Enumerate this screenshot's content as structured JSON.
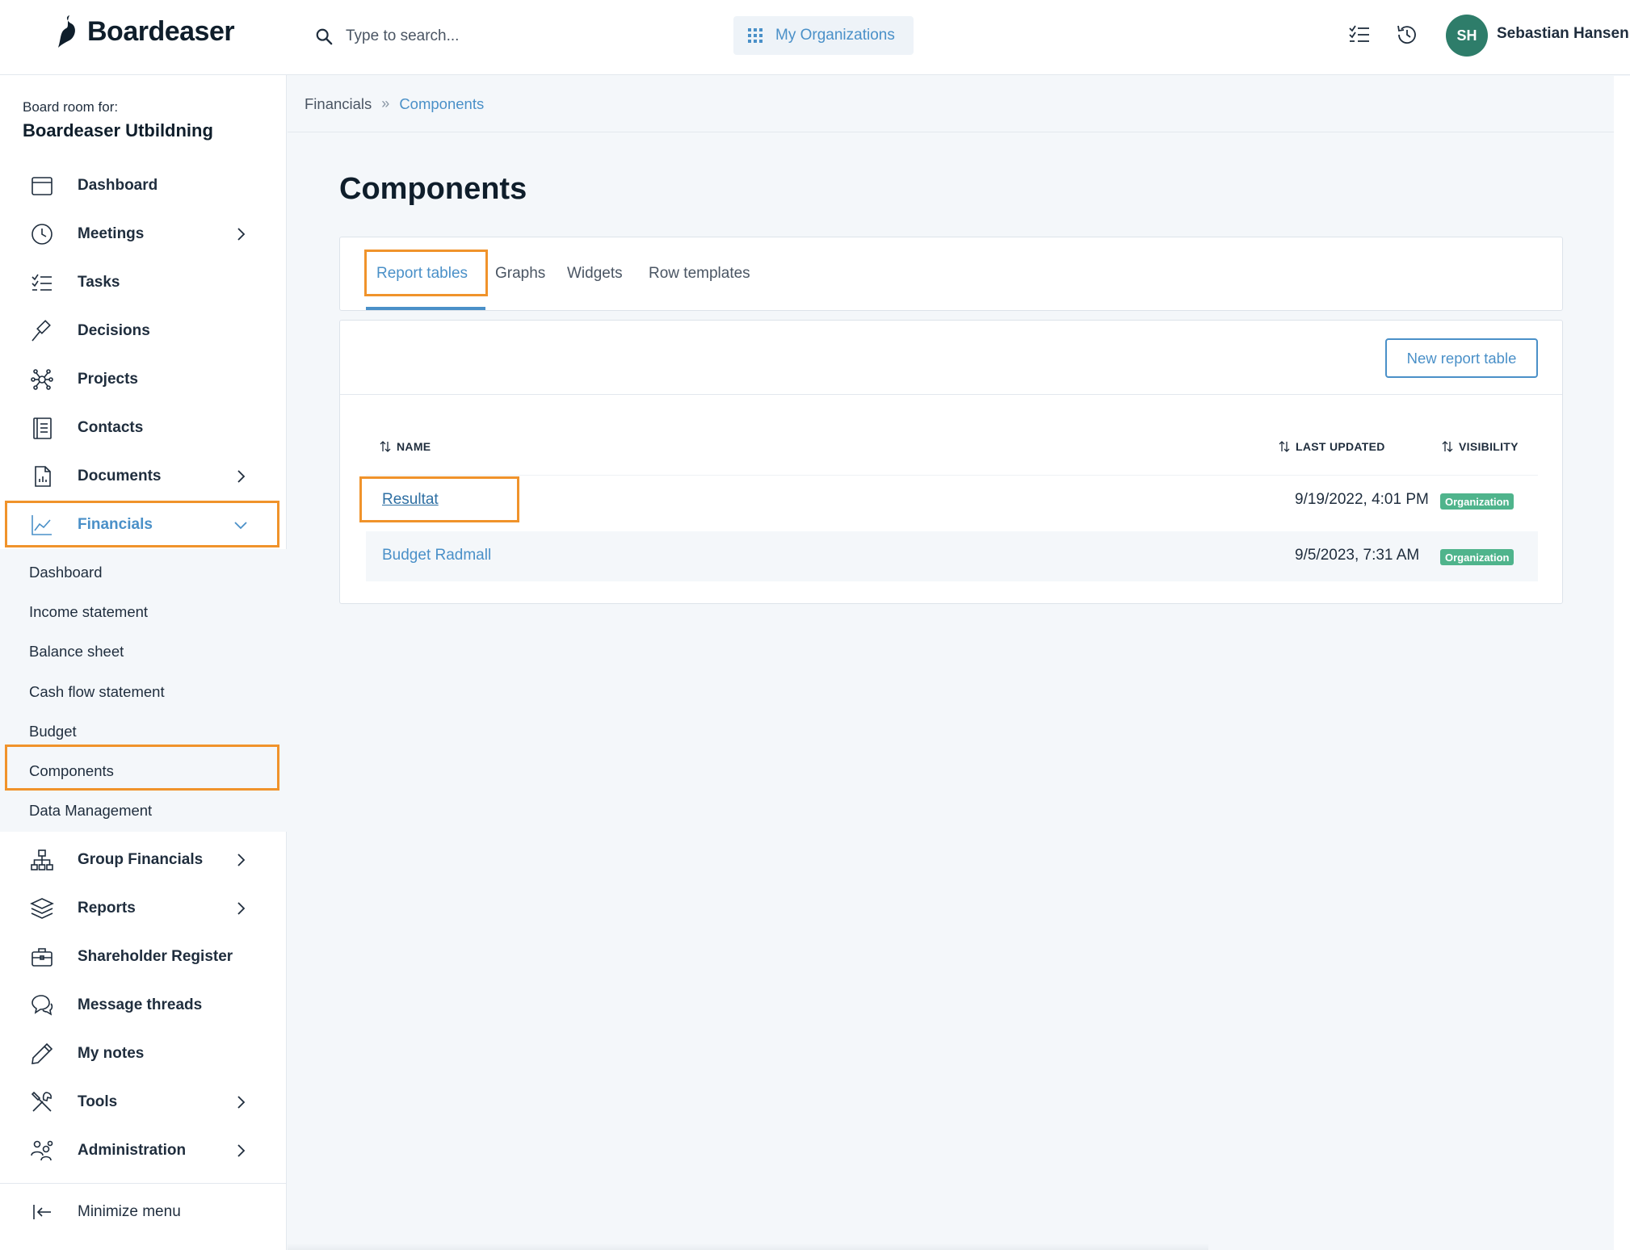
{
  "header": {
    "logo_text": "Boardeaser",
    "search_placeholder": "Type to search...",
    "orgs_label": "My Organizations",
    "user_initials": "SH",
    "user_name": "Sebastian Hansen"
  },
  "sidebar": {
    "room_label": "Board room for:",
    "room_name": "Boardeaser Utbildning",
    "items": [
      {
        "label": "Dashboard",
        "icon": "calendar-icon"
      },
      {
        "label": "Meetings",
        "icon": "clock-icon"
      },
      {
        "label": "Tasks",
        "icon": "checklist-icon"
      },
      {
        "label": "Decisions",
        "icon": "gavel-icon"
      },
      {
        "label": "Projects",
        "icon": "network-icon"
      },
      {
        "label": "Contacts",
        "icon": "contacts-icon"
      },
      {
        "label": "Documents",
        "icon": "document-icon"
      },
      {
        "label": "Financials",
        "icon": "chart-icon"
      }
    ],
    "financials_sub": [
      "Dashboard",
      "Income statement",
      "Balance sheet",
      "Cash flow statement",
      "Budget",
      "Components",
      "Data Management"
    ],
    "items_after": [
      {
        "label": "Group Financials",
        "icon": "hierarchy-icon"
      },
      {
        "label": "Reports",
        "icon": "layers-icon"
      },
      {
        "label": "Shareholder Register",
        "icon": "briefcase-icon"
      },
      {
        "label": "Message threads",
        "icon": "chat-icon"
      },
      {
        "label": "My notes",
        "icon": "pencil-icon"
      },
      {
        "label": "Tools",
        "icon": "tools-icon"
      },
      {
        "label": "Administration",
        "icon": "people-icon"
      }
    ],
    "minimize_label": "Minimize menu"
  },
  "breadcrumb": {
    "parent": "Financials",
    "separator": "»",
    "current": "Components"
  },
  "main": {
    "title": "Components",
    "tabs": [
      "Report tables",
      "Graphs",
      "Widgets",
      "Row templates"
    ],
    "active_tab": "Report tables",
    "new_button": "New report table",
    "table": {
      "columns": [
        "NAME",
        "LAST UPDATED",
        "VISIBILITY"
      ],
      "rows": [
        {
          "name": "Resultat",
          "updated": "9/19/2022, 4:01 PM",
          "visibility": "Organization"
        },
        {
          "name": "Budget Radmall",
          "updated": "9/5/2023, 7:31 AM",
          "visibility": "Organization"
        }
      ]
    }
  },
  "colors": {
    "accent": "#4a90c8",
    "highlight": "#f0932b",
    "badge": "#4fb48c",
    "avatar": "#2e7d6a"
  }
}
